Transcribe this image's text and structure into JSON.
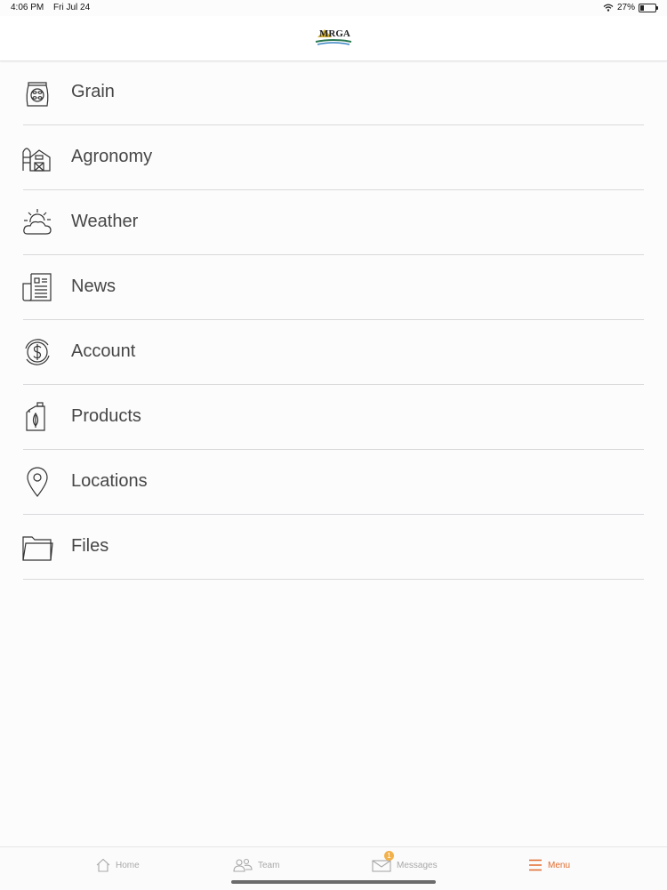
{
  "status_bar": {
    "time": "4:06 PM",
    "date": "Fri Jul 24",
    "battery": "27%"
  },
  "header": {
    "logo_text": "MRGA"
  },
  "menu": {
    "items": [
      {
        "label": "Grain",
        "icon": "grain-bag-icon"
      },
      {
        "label": "Agronomy",
        "icon": "barn-silo-icon"
      },
      {
        "label": "Weather",
        "icon": "sun-cloud-icon"
      },
      {
        "label": "News",
        "icon": "newspaper-icon"
      },
      {
        "label": "Account",
        "icon": "dollar-circle-icon"
      },
      {
        "label": "Products",
        "icon": "jug-leaf-icon"
      },
      {
        "label": "Locations",
        "icon": "map-pin-icon"
      },
      {
        "label": "Files",
        "icon": "folder-icon"
      }
    ]
  },
  "tabbar": {
    "home": "Home",
    "team": "Team",
    "messages": "Messages",
    "messages_badge": "1",
    "menu": "Menu",
    "active_color": "#e26a2c",
    "inactive_color": "#a8a8a8"
  }
}
